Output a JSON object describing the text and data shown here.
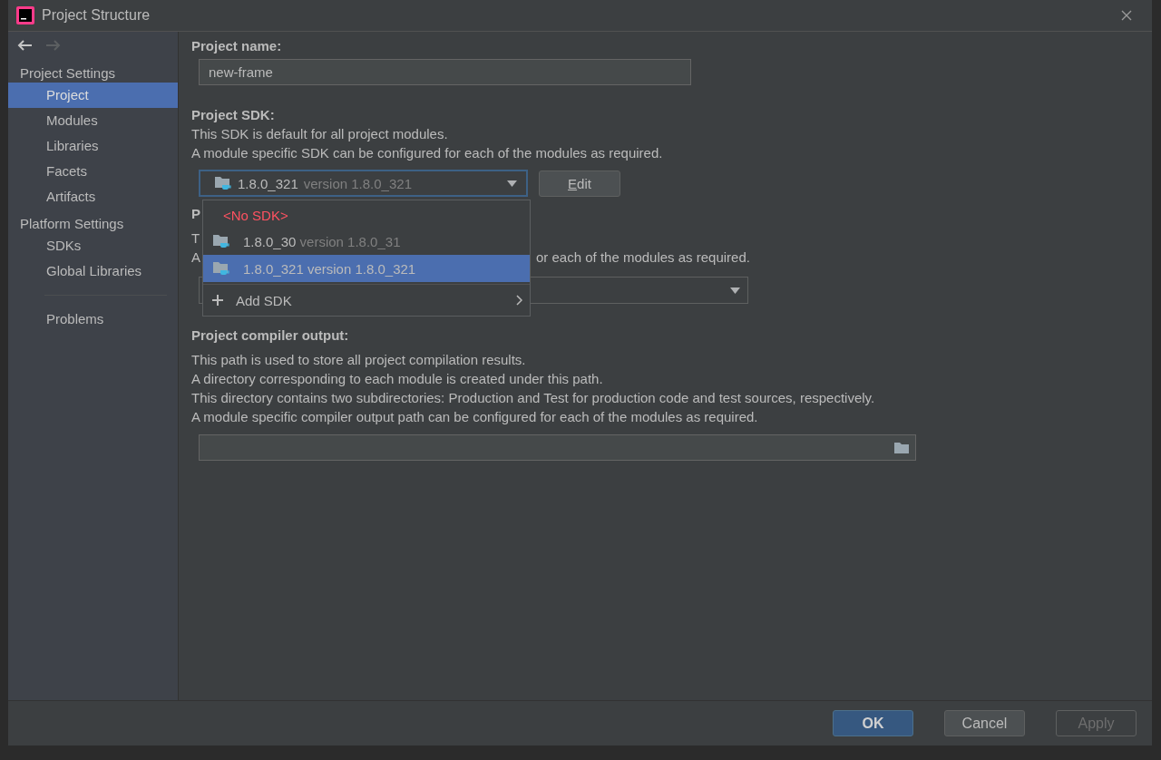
{
  "window": {
    "title": "Project Structure"
  },
  "nav": [
    {
      "kind": "back",
      "disabled": false
    },
    {
      "kind": "forward",
      "disabled": true
    }
  ],
  "sidebar": {
    "items": [
      {
        "kind": "header",
        "label": "Project Settings"
      },
      {
        "kind": "item",
        "label": "Project",
        "selected": true
      },
      {
        "kind": "item",
        "label": "Modules",
        "selected": false
      },
      {
        "kind": "item",
        "label": "Libraries",
        "selected": false
      },
      {
        "kind": "item",
        "label": "Facets",
        "selected": false
      },
      {
        "kind": "item",
        "label": "Artifacts",
        "selected": false
      },
      {
        "kind": "header",
        "label": "Platform Settings"
      },
      {
        "kind": "item",
        "label": "SDKs",
        "selected": false
      },
      {
        "kind": "item",
        "label": "Global Libraries",
        "selected": false
      },
      {
        "kind": "separator"
      },
      {
        "kind": "item",
        "label": "Problems",
        "selected": false
      }
    ]
  },
  "project_name": {
    "label": "Project name:",
    "value": "new-frame"
  },
  "project_sdk": {
    "label": "Project SDK:",
    "lines": [
      "This SDK is default for all project modules.",
      "A module specific SDK can be configured for each of the modules as required."
    ],
    "dropdown": {
      "name": "1.8.0_321",
      "version": "version 1.8.0_321",
      "focused": true
    },
    "edit_button": "Edit"
  },
  "sdk_popup": {
    "items": [
      {
        "kind": "none",
        "label": "<No SDK>",
        "selected": false
      },
      {
        "kind": "sdk",
        "name": "1.8.0_30",
        "version": "version 1.8.0_31",
        "selected": false
      },
      {
        "kind": "sdk",
        "name": "1.8.0_321",
        "version": "version 1.8.0_321",
        "selected": true
      },
      {
        "kind": "add",
        "label": "Add SDK",
        "selected": false
      }
    ]
  },
  "language_level": {
    "label": "P",
    "lines": [
      "T",
      "A"
    ],
    "line_tail": "or each of the modules as required."
  },
  "compiler_output": {
    "label": "Project compiler output:",
    "lines": [
      "This path is used to store all project compilation results.",
      "A directory corresponding to each module is created under this path.",
      "This directory contains two subdirectories: Production and Test for production code and test sources, respectively.",
      "A module specific compiler output path can be configured for each of the modules as required."
    ]
  },
  "buttons": [
    {
      "label": "OK",
      "kind": "default",
      "disabled": false
    },
    {
      "label": "Cancel",
      "kind": "normal",
      "disabled": false
    },
    {
      "label": "Apply",
      "kind": "normal",
      "disabled": true
    }
  ]
}
